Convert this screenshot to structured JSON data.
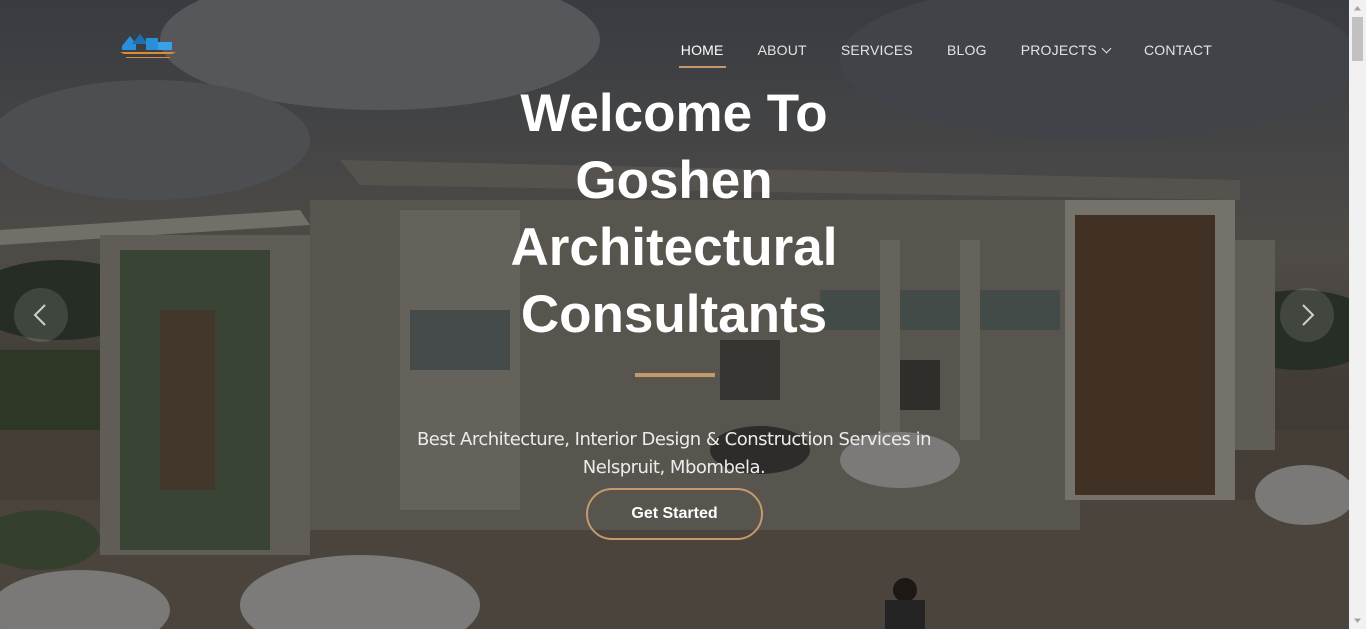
{
  "brand": {
    "logo_icon": "company-logo",
    "accent_color": "#c49a6c"
  },
  "nav": {
    "items": [
      {
        "label": "HOME",
        "active": true
      },
      {
        "label": "ABOUT"
      },
      {
        "label": "SERVICES"
      },
      {
        "label": "BLOG"
      },
      {
        "label": "PROJECTS",
        "has_dropdown": true
      },
      {
        "label": "CONTACT"
      }
    ]
  },
  "hero": {
    "title_lines": [
      "Welcome To",
      "Goshen",
      "Architectural",
      "Consultants"
    ],
    "subtitle_lines": [
      "Best Architecture, Interior Design & Construction Services in",
      "Nelspruit, Mbombela."
    ],
    "cta_label": "Get Started",
    "prev_icon": "chevron-left-icon",
    "next_icon": "chevron-right-icon"
  }
}
